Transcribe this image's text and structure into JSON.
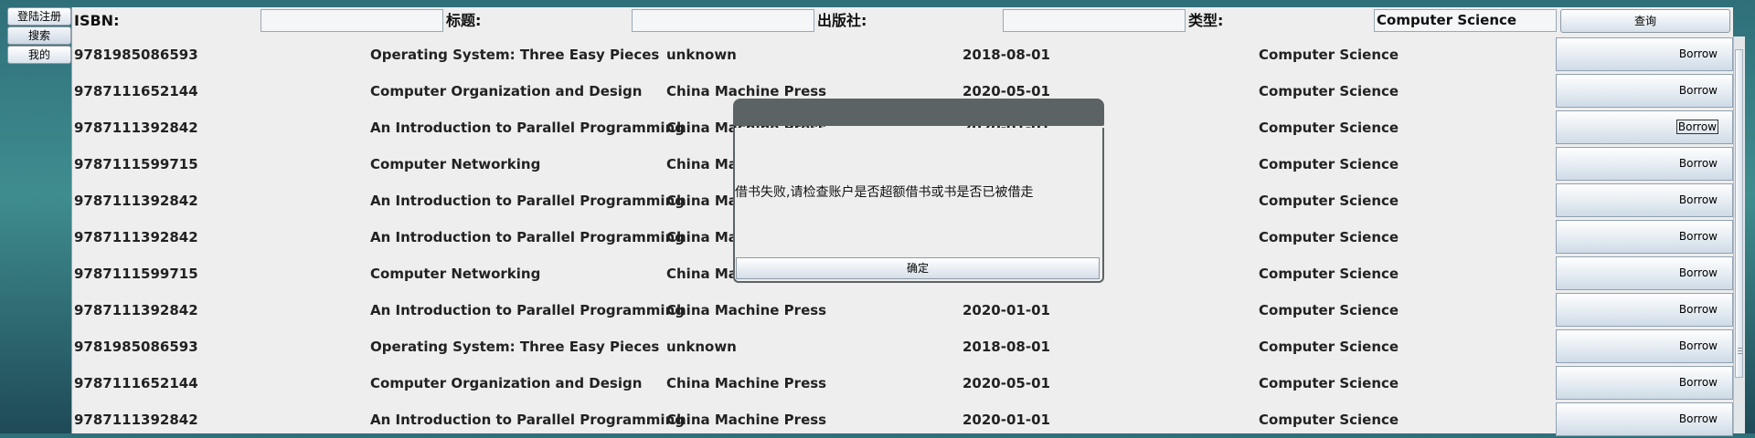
{
  "left_tabs": [
    "登陆注册",
    "搜索",
    "我的"
  ],
  "search": {
    "isbn_label": "ISBN:",
    "isbn_value": "",
    "title_label": "标题:",
    "title_value": "",
    "publisher_label": "出版社:",
    "publisher_value": "",
    "type_label": "类型:",
    "type_value": "Computer Science",
    "query_label": "查询"
  },
  "rows": [
    [
      "9781985086593",
      "Operating System: Three Easy Pieces",
      "unknown",
      "2018-08-01",
      "Computer Science"
    ],
    [
      "9787111652144",
      "Computer Organization and Design",
      "China Machine Press",
      "2020-05-01",
      "Computer Science"
    ],
    [
      "9787111392842",
      "An Introduction to Parallel Programming",
      "China Machine Press",
      "2020-01-01",
      "Computer Science"
    ],
    [
      "9787111599715",
      "Computer Networking",
      "China Mac",
      "",
      "Computer Science"
    ],
    [
      "9787111392842",
      "An Introduction to Parallel Programming",
      "China Mac",
      "",
      "Computer Science"
    ],
    [
      "9787111392842",
      "An Introduction to Parallel Programming",
      "China Mac",
      "",
      "Computer Science"
    ],
    [
      "9787111599715",
      "Computer Networking",
      "China Mac",
      "",
      "Computer Science"
    ],
    [
      "9787111392842",
      "An Introduction to Parallel Programming",
      "China Machine Press",
      "2020-01-01",
      "Computer Science"
    ],
    [
      "9781985086593",
      "Operating System: Three Easy Pieces",
      "unknown",
      "2018-08-01",
      "Computer Science"
    ],
    [
      "9787111652144",
      "Computer Organization and Design",
      "China Machine Press",
      "2020-05-01",
      "Computer Science"
    ],
    [
      "9787111392842",
      "An Introduction to Parallel Programming",
      "China Machine Press",
      "2020-01-01",
      "Computer Science"
    ]
  ],
  "borrow_label": "Borrow",
  "focused_borrow_row": 2,
  "dialog": {
    "title": "",
    "message": "借书失败,请检查账户是否超额借书或书是否已被借走",
    "ok_label": "确定"
  }
}
